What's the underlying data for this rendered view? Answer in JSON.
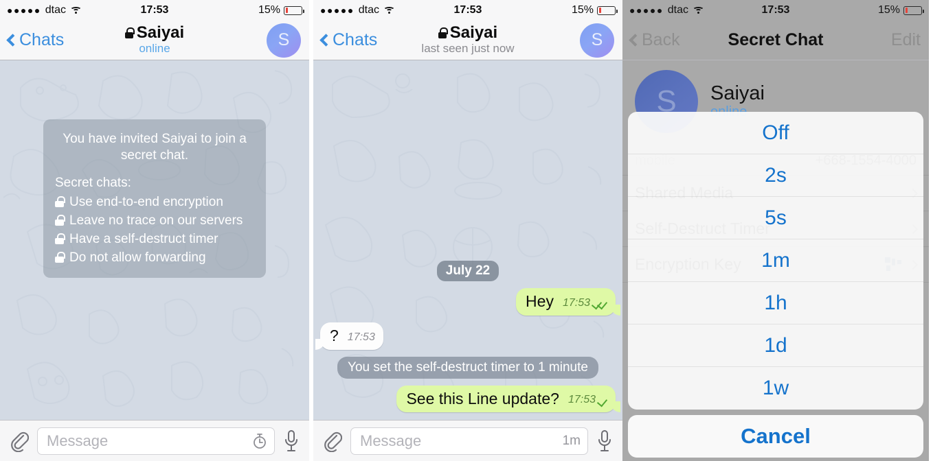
{
  "status_bar": {
    "signal_dots": "●●●●●",
    "carrier": "dtac",
    "time": "17:53",
    "battery_percent": "15%",
    "battery_level": 15,
    "battery_color": "#e8433a"
  },
  "panel1": {
    "nav": {
      "back_label": "Chats",
      "title": "Saiyai",
      "subtitle": "online",
      "subtitle_color": "#5aa7e8",
      "avatar_initial": "S"
    },
    "info_bubble": {
      "heading": "You have invited Saiyai to join a secret chat.",
      "lead": "Secret chats:",
      "items": [
        "Use end-to-end encryption",
        "Leave no trace on our servers",
        "Have a self-destruct timer",
        "Do not allow forwarding"
      ]
    },
    "input": {
      "placeholder": "Message",
      "timer_icon": "stopwatch-icon",
      "attach_icon": "paperclip-icon",
      "mic_icon": "microphone-icon"
    }
  },
  "panel2": {
    "nav": {
      "back_label": "Chats",
      "title": "Saiyai",
      "subtitle": "last seen just now",
      "subtitle_color": "#8a8a8f",
      "avatar_initial": "S"
    },
    "date_separator": "July 22",
    "messages": [
      {
        "kind": "outgoing",
        "text": "Hey",
        "time": "17:53",
        "ticks": 2
      },
      {
        "kind": "incoming",
        "text": "?",
        "time": "17:53",
        "ticks": 0
      },
      {
        "kind": "service",
        "text": "You set the self-destruct timer to 1 minute"
      },
      {
        "kind": "outgoing",
        "text": "See this Line update?",
        "time": "17:53",
        "ticks": 1
      }
    ],
    "input": {
      "placeholder": "Message",
      "timer_value": "1m",
      "attach_icon": "paperclip-icon",
      "mic_icon": "microphone-icon"
    }
  },
  "panel3": {
    "nav": {
      "back_label": "Back",
      "title": "Secret Chat",
      "edit_label": "Edit"
    },
    "profile": {
      "name": "Saiyai",
      "status": "online",
      "avatar_initial": "S"
    },
    "rows": [
      {
        "label": "mobile",
        "value": "+668-1554-4000",
        "small": true
      },
      {
        "label": "Shared Media",
        "value": "",
        "small": false
      },
      {
        "label": "Self-Destruct Timer",
        "value": "",
        "small": false
      },
      {
        "label": "Encryption Key",
        "value": "qr-thumbnail",
        "small": false
      }
    ],
    "action_sheet": {
      "options": [
        "Off",
        "2s",
        "5s",
        "1m",
        "1h",
        "1d",
        "1w"
      ],
      "cancel_label": "Cancel",
      "accent_color": "#1573cc"
    }
  }
}
